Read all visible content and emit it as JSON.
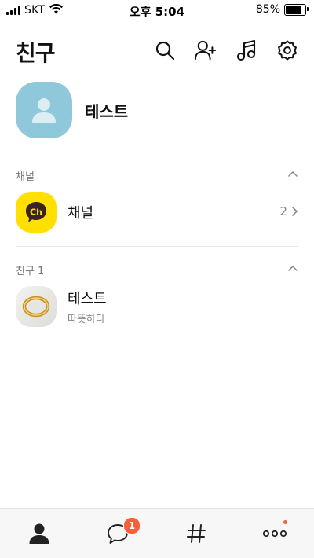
{
  "status_bar": {
    "carrier": "SKT",
    "time": "오후 5:04",
    "battery_percent": "85%",
    "battery_level": 0.85
  },
  "header": {
    "title": "친구",
    "icons": [
      "search-icon",
      "add-friend-icon",
      "music-icon",
      "settings-icon"
    ]
  },
  "profile": {
    "name": "테스트",
    "avatar_color": "#8fc8db"
  },
  "channel_section": {
    "label": "채널",
    "item": {
      "title": "채널",
      "count": "2",
      "avatar_text": "Ch",
      "avatar_color": "#ffe000"
    }
  },
  "friends_section": {
    "label": "친구 1",
    "friends": [
      {
        "name": "테스트",
        "status": "따뜻하다"
      }
    ]
  },
  "tab_bar": {
    "tabs": [
      "friends-tab",
      "chats-tab",
      "openchat-tab",
      "more-tab"
    ],
    "chat_badge": "1",
    "accent_color": "#f5613d"
  }
}
